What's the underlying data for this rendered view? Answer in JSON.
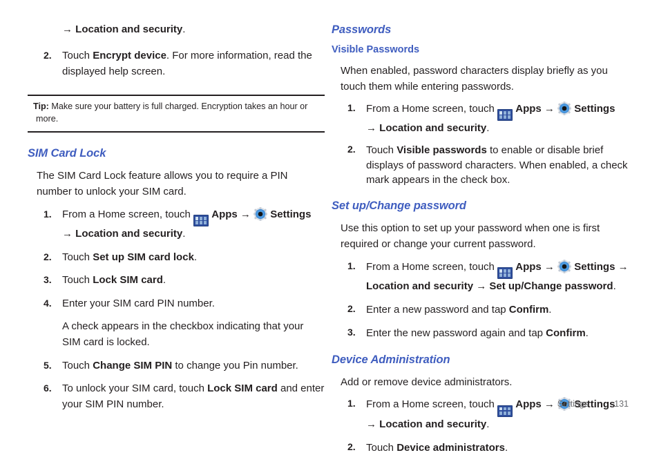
{
  "icons": {
    "apps": "apps-grid-icon",
    "settings": "gear-icon",
    "arrow": "→"
  },
  "colors": {
    "heading_blue": "#3f5dbf",
    "body_black": "#231f20",
    "footer_gray": "#6d6e71",
    "apps_icon_blue": "#2f4f9e"
  },
  "left_column": {
    "continued_step_line": {
      "arrow": "→",
      "bold_text": "Location and security",
      "trailing": "."
    },
    "encrypt_step": {
      "num": "2.",
      "lead": "Touch ",
      "bold": "Encrypt device",
      "rest": ". For more information, read the displayed help screen."
    },
    "tip": {
      "label": "Tip:",
      "text": "Make sure your battery is full charged. Encryption takes an hour or more."
    },
    "sim_card_lock": {
      "heading": "SIM Card Lock",
      "intro": "The SIM Card Lock feature allows you to require a PIN number to unlock your SIM card.",
      "steps": [
        {
          "num": "1.",
          "part1": "From a Home screen, touch ",
          "apps_label": "Apps",
          "arrow1": "→",
          "settings_label": "Settings",
          "arrow2": "→",
          "bold_tail": "Location and security",
          "period": "."
        },
        {
          "num": "2.",
          "lead": "Touch ",
          "bold": "Set up SIM card lock",
          "rest": "."
        },
        {
          "num": "3.",
          "lead": "Touch ",
          "bold": "Lock SIM card",
          "rest": "."
        },
        {
          "num": "4.",
          "lead": "Enter your SIM card PIN number.",
          "bold": "",
          "rest": "",
          "sub": "A check appears in the checkbox indicating that your SIM card is locked."
        },
        {
          "num": "5.",
          "lead": "Touch ",
          "bold": "Change SIM PIN",
          "rest": " to change you Pin number."
        },
        {
          "num": "6.",
          "lead": "To unlock your SIM card, touch ",
          "bold": "Lock SIM card",
          "rest": " and enter your SIM PIN number."
        }
      ]
    }
  },
  "right_column": {
    "passwords": {
      "heading": "Passwords",
      "subheading": "Visible Passwords",
      "intro": "When enabled, password characters display briefly as you touch them while entering passwords.",
      "step1": {
        "num": "1.",
        "part1": "From a Home screen, touch ",
        "apps_label": "Apps",
        "arrow1": "→",
        "settings_label": "Settings",
        "arrow2": "→",
        "bold_tail": "Location and security",
        "period": "."
      },
      "step2": {
        "num": "2.",
        "lead": "Touch ",
        "bold": "Visible passwords",
        "rest": " to enable or disable brief displays of password characters. When enabled, a check mark appears in the check box."
      }
    },
    "set_up_change_password": {
      "heading": "Set up/Change password",
      "intro": "Use this option to set up your password when one is first required or change your current password.",
      "step1": {
        "num": "1.",
        "part1": "From a Home screen, touch ",
        "apps_label": "Apps",
        "arrow1": "→",
        "settings_label": "Settings",
        "arrow2": "→",
        "bold_tail": "Location and security → Set up/Change password",
        "period": "."
      },
      "step2": {
        "num": "2.",
        "lead": "Enter a new password and tap ",
        "bold": "Confirm",
        "rest": "."
      },
      "step3": {
        "num": "3.",
        "lead": "Enter the new password again and tap ",
        "bold": "Confirm",
        "rest": "."
      }
    },
    "device_administration": {
      "heading": "Device Administration",
      "intro": "Add or remove device administrators.",
      "step1": {
        "num": "1.",
        "part1": "From a Home screen, touch ",
        "apps_label": "Apps",
        "arrow1": "→",
        "settings_label": "Settings",
        "arrow2": "→",
        "bold_tail": "Location and security",
        "period": "."
      },
      "step2": {
        "num": "2.",
        "lead": "Touch ",
        "bold": "Device administrators",
        "rest": "."
      }
    }
  },
  "footer": {
    "label": "Settings",
    "page_number": "131"
  }
}
